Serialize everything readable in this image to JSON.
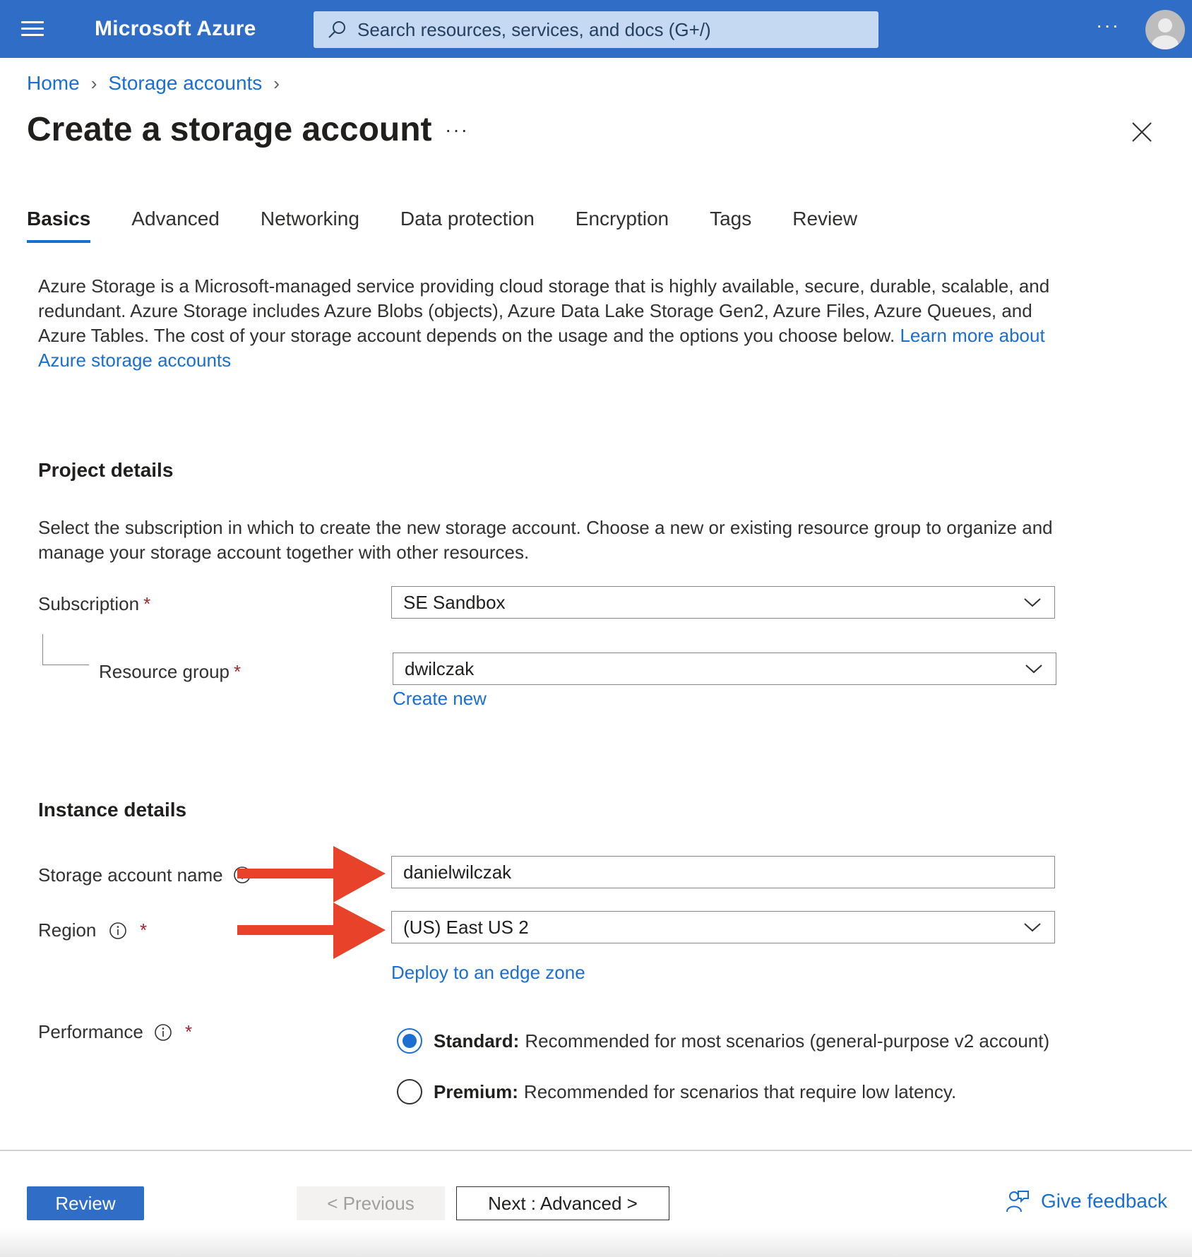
{
  "topbar": {
    "brand": "Microsoft Azure",
    "search_placeholder": "Search resources, services, and docs (G+/)",
    "more": "···"
  },
  "breadcrumb": [
    {
      "label": "Home"
    },
    {
      "label": "Storage accounts"
    }
  ],
  "page": {
    "title": "Create a storage account",
    "more": "···"
  },
  "tabs": [
    {
      "label": "Basics",
      "active": true
    },
    {
      "label": "Advanced"
    },
    {
      "label": "Networking"
    },
    {
      "label": "Data protection"
    },
    {
      "label": "Encryption"
    },
    {
      "label": "Tags"
    },
    {
      "label": "Review"
    }
  ],
  "intro": {
    "text": "Azure Storage is a Microsoft-managed service providing cloud storage that is highly available, secure, durable, scalable, and redundant. Azure Storage includes Azure Blobs (objects), Azure Data Lake Storage Gen2, Azure Files, Azure Queues, and Azure Tables. The cost of your storage account depends on the usage and the options you choose below.",
    "link": "Learn more about Azure storage accounts"
  },
  "project": {
    "title": "Project details",
    "description": "Select the subscription in which to create the new storage account. Choose a new or existing resource group to organize and manage your storage account together with other resources.",
    "subscription_label": "Subscription",
    "subscription_value": "SE Sandbox",
    "resource_group_label": "Resource group",
    "resource_group_value": "dwilczak",
    "create_new": "Create new",
    "required_mark": "*"
  },
  "instance": {
    "title": "Instance details",
    "name_label": "Storage account name",
    "name_value": "danielwilczak",
    "region_label": "Region",
    "region_value": "(US) East US 2",
    "edge_zone_link": "Deploy to an edge zone",
    "performance_label": "Performance",
    "required_mark": "*",
    "performance_options": [
      {
        "name": "Standard:",
        "desc": "Recommended for most scenarios (general-purpose v2 account)",
        "checked": true
      },
      {
        "name": "Premium:",
        "desc": "Recommended for scenarios that require low latency.",
        "checked": false
      }
    ]
  },
  "footer": {
    "review": "Review",
    "previous": "< Previous",
    "next": "Next : Advanced >",
    "feedback": "Give feedback"
  },
  "colors": {
    "brand_blue": "#2f6dc7",
    "link_blue": "#1a6fd0",
    "arrow_red": "#e8432a",
    "required_red": "#a4262c"
  }
}
